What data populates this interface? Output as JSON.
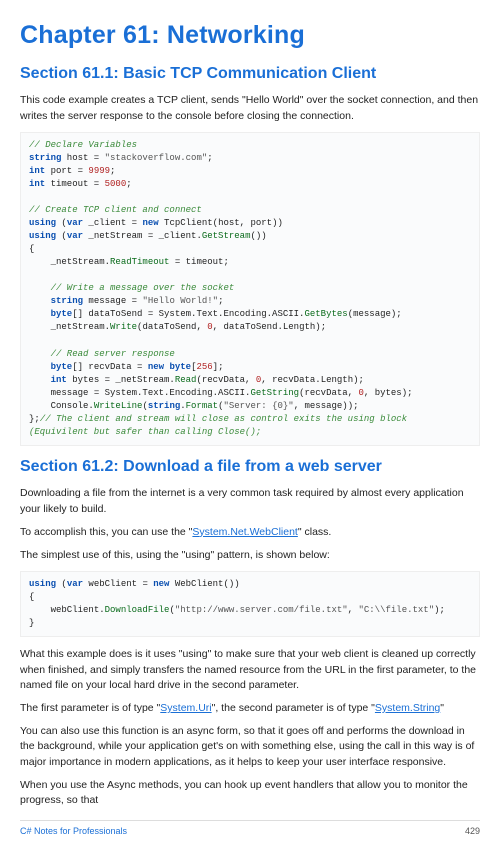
{
  "chapter": {
    "title": "Chapter 61: Networking"
  },
  "section1": {
    "title": "Section 61.1: Basic TCP Communication Client",
    "intro": "This code example creates a TCP client, sends \"Hello World\" over the socket connection, and then writes the server response to the console before closing the connection."
  },
  "code1": {
    "c_declare": "// Declare Variables",
    "kw_string1": "string",
    "host_var": " host = ",
    "host_val": "\"stackoverflow.com\"",
    "kw_int1": "int",
    "port_var": " port = ",
    "port_val": "9999",
    "kw_int2": "int",
    "timeout_var": " timeout = ",
    "timeout_val": "5000",
    "c_create": "// Create TCP client and connect",
    "kw_using1": "using",
    "kw_var1": "var",
    "using1_text": " _client = ",
    "kw_new1": "new",
    "tcp_ctor": " TcpClient(host, port))",
    "kw_using2": "using",
    "kw_var2": "var",
    "using2_text": " _netStream = _client.",
    "getstream": "GetStream",
    "paren_empty": "())",
    "readtimeout": "ReadTimeout",
    "rt_assign": " = timeout;",
    "c_write": "// Write a message over the socket",
    "kw_string2": "string",
    "msg_var": " message = ",
    "msg_val": "\"Hello World!\"",
    "kw_byte1": "byte",
    "dts_var": "[] dataToSend = System.Text.Encoding.ASCII.",
    "getbytes": "GetBytes",
    "getbytes_args": "(message);",
    "write": "Write",
    "write_args1": "(dataToSend, ",
    "zero1": "0",
    "write_args2": ", dataToSend.Length);",
    "c_read": "// Read server response",
    "kw_byte2": "byte",
    "recv_var": "[] recvData = ",
    "kw_new2": "new",
    "kw_byte3": "byte",
    "arr256a": "[",
    "n256": "256",
    "arr256b": "];",
    "kw_int3": "int",
    "bytes_var": " bytes = _netStream.",
    "read": "Read",
    "read_args1": "(recvData, ",
    "zero2": "0",
    "read_args2": ", recvData.Length);",
    "msg_assign": "    message = System.Text.Encoding.ASCII.",
    "getstring": "GetString",
    "gs_args1": "(recvData, ",
    "zero3": "0",
    "gs_args2": ", bytes);",
    "console": "    Console.",
    "writeline": "WriteLine",
    "wl_args1": "(",
    "kw_string3": "string",
    "format": "Format",
    "fmt_args1": "(",
    "fmt_str": "\"Server: {0}\"",
    "fmt_args2": ", message));",
    "c_close": "// The client and stream will close as control exits the using block (Equivilent but safer than calling Close();"
  },
  "section2": {
    "title": "Section 61.2: Download a file from a web server",
    "p1": "Downloading a file from the internet is a very common task required by almost every application your likely to build.",
    "p2a": "To accomplish this, you can use the \"",
    "p2_link": "System.Net.WebClient",
    "p2b": "\" class.",
    "p3": "The simplest use of this, using the \"using\" pattern, is shown below:"
  },
  "code2": {
    "kw_using": "using",
    "kw_var": "var",
    "wc_var": " webClient = ",
    "kw_new": "new",
    "wc_ctor": " WebClient())",
    "downloadfile": "DownloadFile",
    "df_args1": "(",
    "url": "\"http://www.server.com/file.txt\"",
    "df_args2": ", ",
    "path": "\"C:\\\\file.txt\"",
    "df_args3": ");"
  },
  "after": {
    "p4": "What this example does is it uses \"using\" to make sure that your web client is cleaned up correctly when finished, and simply transfers the named resource from the URL in the first parameter, to the named file on your local hard drive in the second parameter.",
    "p5a": "The first parameter is of type \"",
    "p5_link1": "System.Uri",
    "p5b": "\", the second parameter is of type \"",
    "p5_link2": "System.String",
    "p5c": "\"",
    "p6": "You can also use this function is an async form, so that it goes off and performs the download in the background, while your application get's on with something else, using the call in this way is of major importance in modern applications, as it helps to keep your user interface responsive.",
    "p7": "When you use the Async methods, you can hook up event handlers that allow you to monitor the progress, so that"
  },
  "footer": {
    "left": "C# Notes for Professionals",
    "right": "429"
  }
}
